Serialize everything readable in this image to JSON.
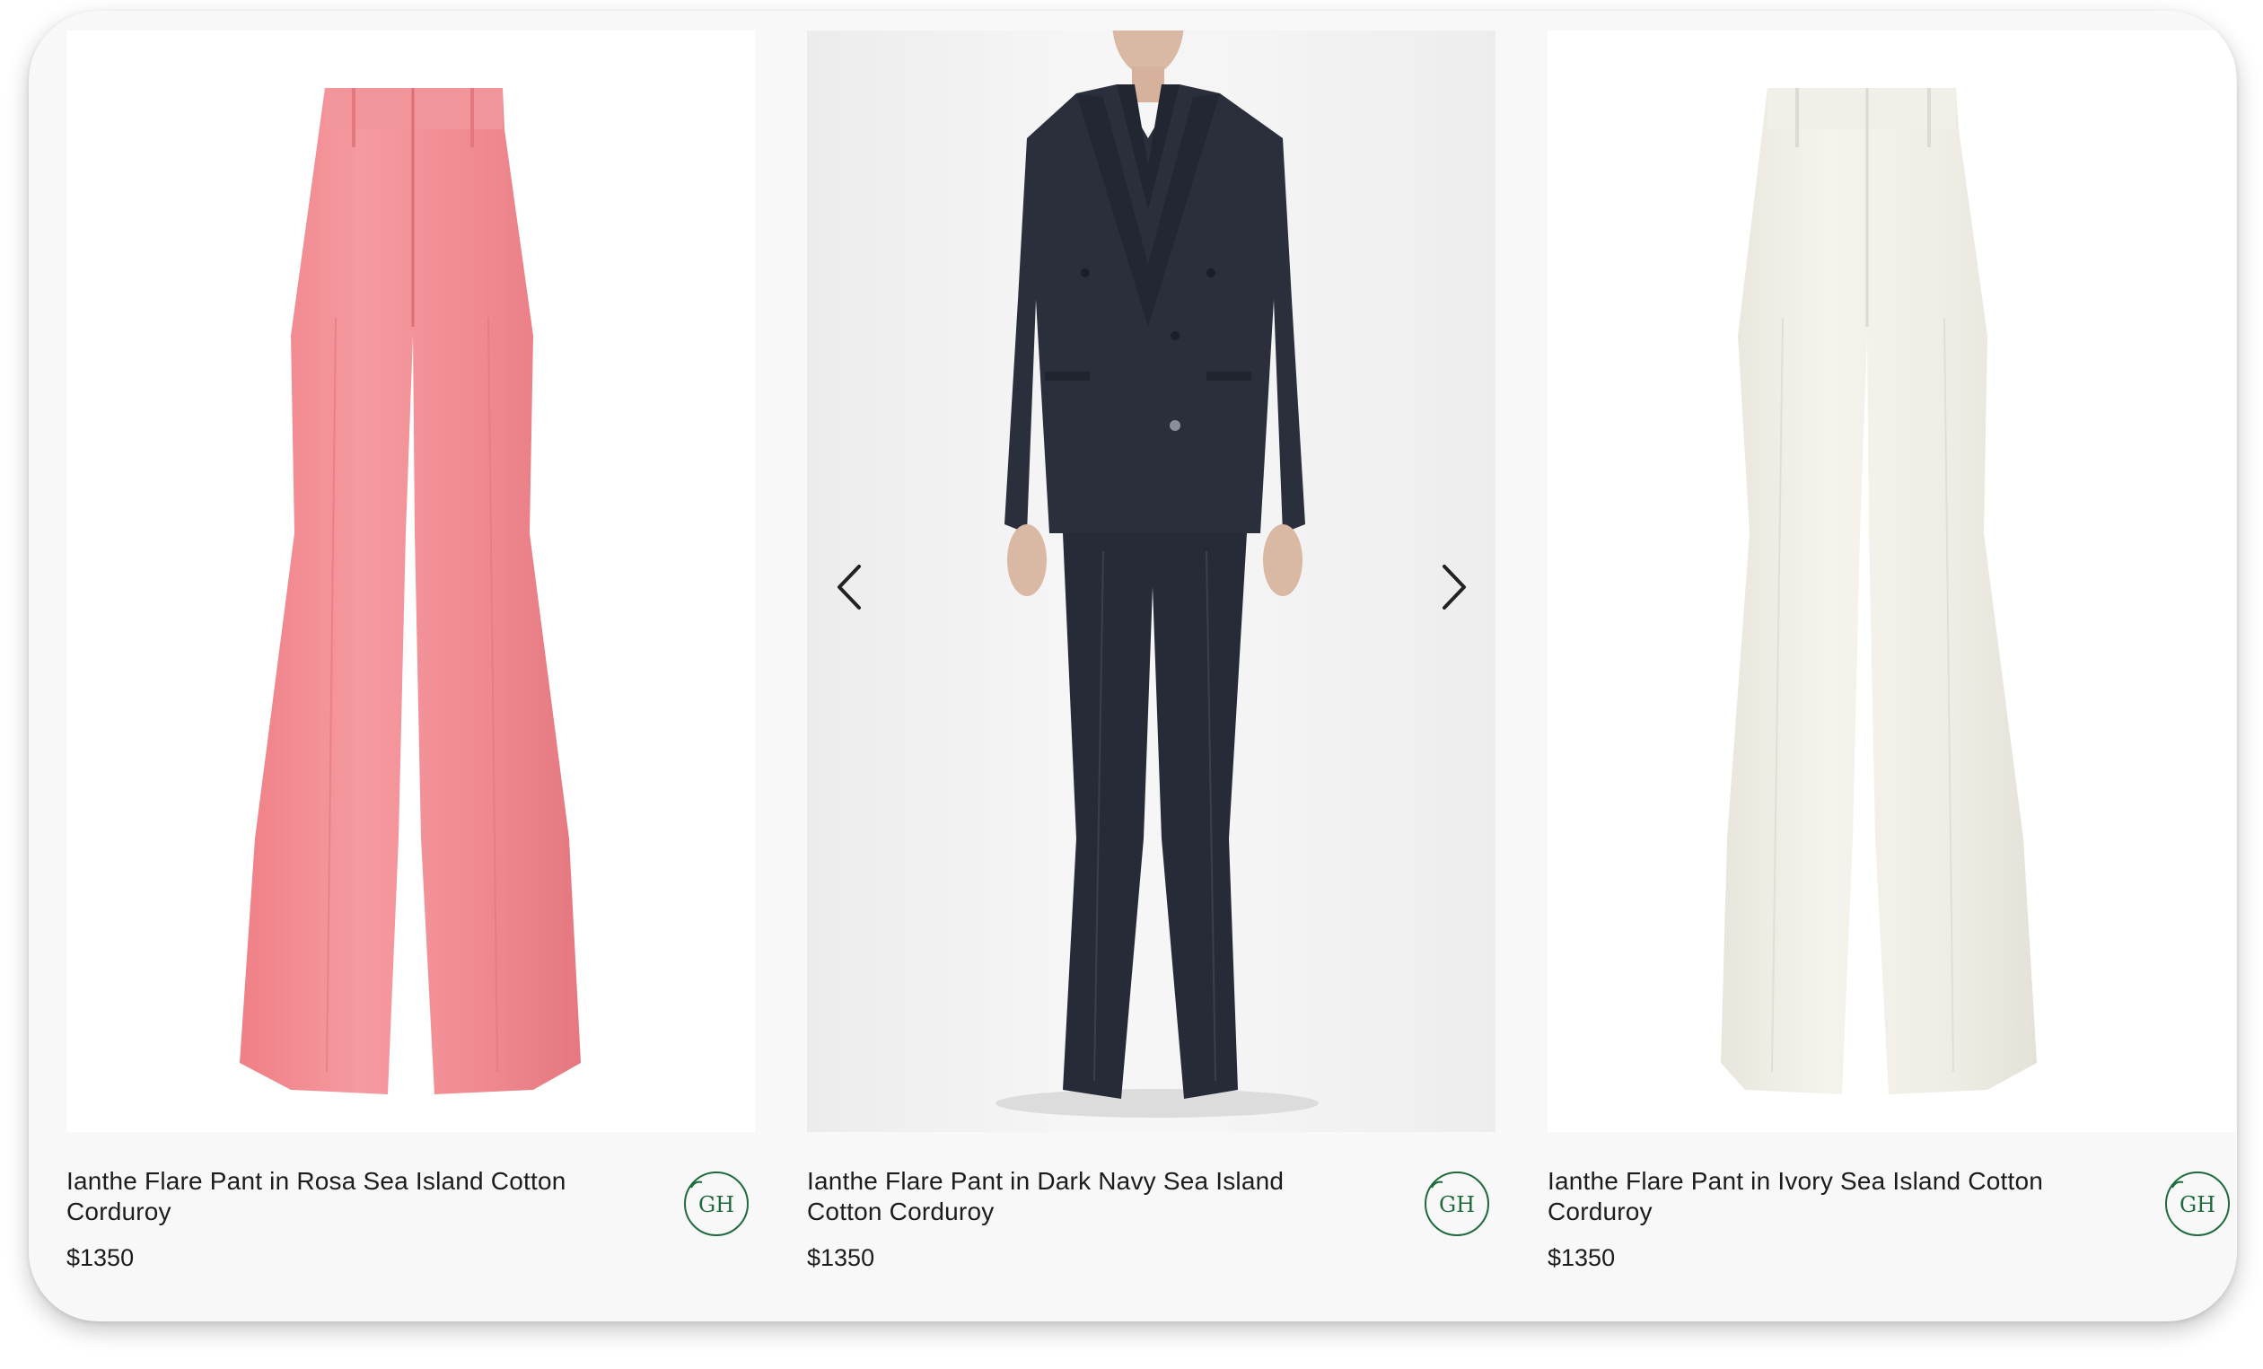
{
  "products": [
    {
      "title": "Ianthe Flare Pant in Rosa Sea Island Cotton Corduroy",
      "price": "$1350",
      "color_hex": "#f28e93",
      "badge": "GH"
    },
    {
      "title": "Ianthe Flare Pant in Dark Navy Sea Island Cotton Corduroy",
      "price": "$1350",
      "color_hex": "#262a36",
      "badge": "GH"
    },
    {
      "title": "Ianthe Flare Pant in Ivory Sea Island Cotton Corduroy",
      "price": "$1350",
      "color_hex": "#f2f0e8",
      "badge": "GH"
    }
  ],
  "carousel": {
    "prev_icon": "chevron-left-icon",
    "next_icon": "chevron-right-icon"
  },
  "accent_color": "#1e6a3a"
}
